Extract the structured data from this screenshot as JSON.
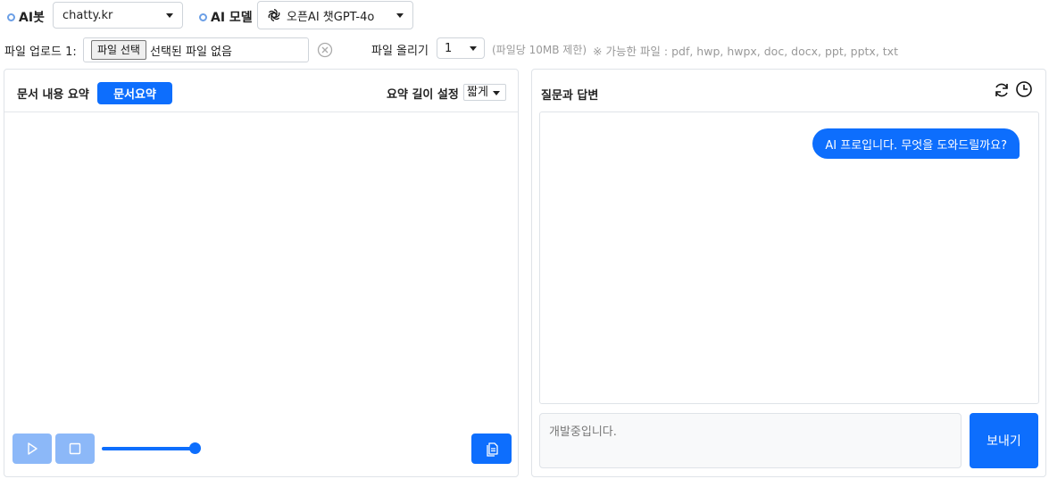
{
  "top": {
    "ai_bot_label": "AI봇",
    "ai_bot_value": "chatty.kr",
    "ai_model_label": "AI 모델",
    "ai_model_value": "오픈AI 챗GPT-4o",
    "ai_model_icon": "openai-logo-icon"
  },
  "upload": {
    "label": "파일 업로드 1:",
    "choose_button": "파일 선택",
    "no_file_text": "선택된 파일 없음",
    "upload_count_label": "파일 올리기",
    "upload_count_value": "1",
    "size_note": "(파일당 10MB 제한)",
    "allowed_note": "※ 가능한 파일 : pdf, hwp, hwpx, doc, docx, ppt, pptx, txt"
  },
  "summary": {
    "title": "문서 내용 요약",
    "action_button": "문서요약",
    "length_label": "요약 길이 설정",
    "length_value": "짧게"
  },
  "chat": {
    "title": "질문과 답변",
    "messages": [
      {
        "role": "assistant",
        "text": "AI 프로입니다. 무엇을 도와드릴까요?"
      }
    ],
    "input_placeholder": "개발중입니다.",
    "send_button": "보내기"
  },
  "colors": {
    "primary": "#0d6efd",
    "primary_light": "#8cb8f8"
  }
}
